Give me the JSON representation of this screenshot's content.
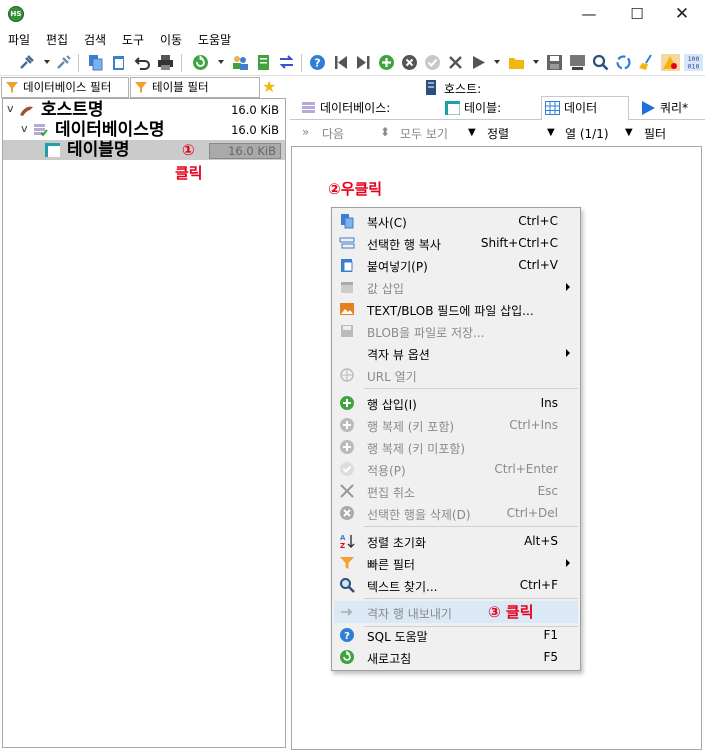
{
  "window": {
    "logo_text": "HS",
    "min_glyph": "—",
    "max_glyph": "☐",
    "close_glyph": "✕"
  },
  "menu": [
    "파일",
    "편집",
    "검색",
    "도구",
    "이동",
    "도움말"
  ],
  "filters": {
    "db_filter": "데이터베이스 필터",
    "table_filter": "테이블 필터"
  },
  "tree": [
    {
      "name": "호스트명",
      "size": "16.0 KiB",
      "icon": "host-icon"
    },
    {
      "name": "데이터베이스명",
      "size": "16.0 KiB",
      "icon": "database-icon"
    },
    {
      "name": "테이블명",
      "size": "16.0 KiB",
      "icon": "table-icon",
      "selected": true
    }
  ],
  "host_label": "호스트:",
  "tabs": [
    {
      "label": "데이터베이스:",
      "icon": "database-icon"
    },
    {
      "label": "테이블:",
      "icon": "table-icon"
    },
    {
      "label": "데이터",
      "icon": "grid-icon",
      "active": true
    },
    {
      "label": "쿼리*",
      "icon": "play-icon"
    }
  ],
  "data_toolbar": {
    "next": "다음",
    "show_all": "모두 보기",
    "sort": "정렬",
    "columns": "열 (1/1)",
    "filter": "필터"
  },
  "annotations": {
    "step1_mark": "①",
    "step1_text": "클릭",
    "step2_text": "②우클릭",
    "step3_text": "③ 클릭"
  },
  "context_menu": [
    {
      "label": "복사(C)",
      "shortcut": "Ctrl+C",
      "icon": "copy-icon",
      "enabled": true
    },
    {
      "label": "선택한 행 복사",
      "shortcut": "Shift+Ctrl+C",
      "icon": "copy-rows-icon",
      "enabled": true
    },
    {
      "label": "붙여넣기(P)",
      "shortcut": "Ctrl+V",
      "icon": "paste-icon",
      "enabled": true
    },
    {
      "label": "값 삽입",
      "shortcut": "",
      "icon": "calendar-icon",
      "enabled": false,
      "submenu": true
    },
    {
      "label": "TEXT/BLOB 필드에 파일 삽입...",
      "shortcut": "",
      "icon": "image-icon",
      "enabled": true
    },
    {
      "label": "BLOB을 파일로 저장...",
      "shortcut": "",
      "icon": "save-icon",
      "enabled": false
    },
    {
      "label": "격자 뷰 옵션",
      "shortcut": "",
      "icon": "",
      "enabled": true,
      "submenu": true
    },
    {
      "label": "URL 열기",
      "shortcut": "",
      "icon": "globe-icon",
      "enabled": false
    },
    {
      "label": "행 삽입(I)",
      "shortcut": "Ins",
      "icon": "plus-circle-icon",
      "enabled": true
    },
    {
      "label": "행 복제 (키 포함)",
      "shortcut": "Ctrl+Ins",
      "icon": "plus-circle-icon",
      "enabled": false
    },
    {
      "label": "행 복제 (키 미포함)",
      "shortcut": "",
      "icon": "plus-circle-icon",
      "enabled": false
    },
    {
      "label": "적용(P)",
      "shortcut": "Ctrl+Enter",
      "icon": "check-icon",
      "enabled": false
    },
    {
      "label": "편집 취소",
      "shortcut": "Esc",
      "icon": "cross-icon",
      "enabled": false
    },
    {
      "label": "선택한 행을 삭제(D)",
      "shortcut": "Ctrl+Del",
      "icon": "x-circle-icon",
      "enabled": false
    },
    {
      "label": "정렬 초기화",
      "shortcut": "Alt+S",
      "icon": "sort-az-icon",
      "enabled": true
    },
    {
      "label": "빠른 필터",
      "shortcut": "",
      "icon": "funnel-icon",
      "enabled": true,
      "submenu": true
    },
    {
      "label": "텍스트 찾기...",
      "shortcut": "Ctrl+F",
      "icon": "search-icon",
      "enabled": true
    },
    {
      "label": "격자 행 내보내기",
      "shortcut": "",
      "icon": "export-arrow-icon",
      "enabled": false,
      "highlighted": true
    },
    {
      "label": "SQL 도움말",
      "shortcut": "F1",
      "icon": "help-icon",
      "enabled": true
    },
    {
      "label": "새로고침",
      "shortcut": "F5",
      "icon": "refresh-icon",
      "enabled": true
    }
  ],
  "colors": {
    "accent_red": "#e6001b",
    "highlight_row": "#dbe8f6",
    "menu_bg": "#f0f0f0",
    "selected_tree_row": "#cbcbcb"
  }
}
